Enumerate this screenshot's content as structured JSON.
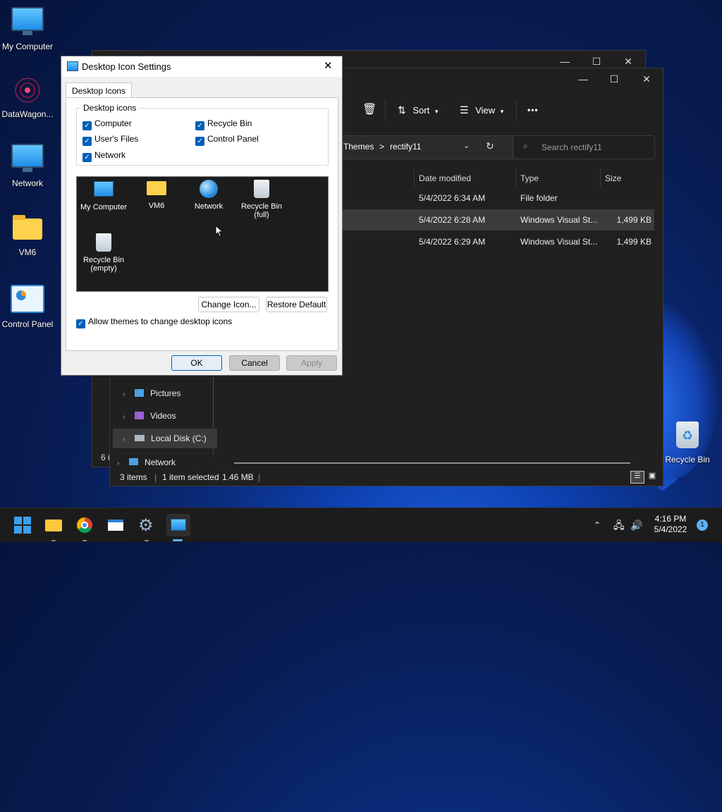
{
  "desktop": {
    "icons": [
      {
        "label": "My Computer"
      },
      {
        "label": "DataWagon..."
      },
      {
        "label": "Network"
      },
      {
        "label": "VM6"
      },
      {
        "label": "Control Panel"
      },
      {
        "label": "Recycle Bin"
      }
    ]
  },
  "explorer": {
    "toolbar": {
      "sort": "Sort",
      "view": "View",
      "more": "•••"
    },
    "address": {
      "crumb1": "Themes",
      "sep": ">",
      "crumb2": "rectify11"
    },
    "search": {
      "placeholder": "Search rectify11"
    },
    "columns": {
      "modified": "Date modified",
      "type": "Type",
      "size": "Size"
    },
    "rows": [
      {
        "modified": "5/4/2022 6:34 AM",
        "type": "File folder",
        "size": ""
      },
      {
        "modified": "5/4/2022 6:28 AM",
        "type": "Windows Visual St...",
        "size": "1,499 KB"
      },
      {
        "modified": "5/4/2022 6:29 AM",
        "type": "Windows Visual St...",
        "size": "1,499 KB"
      }
    ],
    "nav": [
      {
        "label": "Pictures"
      },
      {
        "label": "Videos"
      },
      {
        "label": "Local Disk (C:)"
      },
      {
        "label": "Network"
      }
    ],
    "back_status": "6 i",
    "status": {
      "items": "3 items",
      "selected": "1 item selected",
      "size": "1.46 MB"
    }
  },
  "dialog": {
    "title": "Desktop Icon Settings",
    "tab": "Desktop Icons",
    "group_label": "Desktop icons",
    "checkboxes": [
      {
        "label": "Computer",
        "checked": true
      },
      {
        "label": "Recycle Bin",
        "checked": true
      },
      {
        "label": "User's Files",
        "checked": true
      },
      {
        "label": "Control Panel",
        "checked": true
      },
      {
        "label": "Network",
        "checked": true
      }
    ],
    "preview": [
      {
        "line1": "My Computer",
        "line2": ""
      },
      {
        "line1": "VM6",
        "line2": ""
      },
      {
        "line1": "Network",
        "line2": ""
      },
      {
        "line1": "Recycle Bin",
        "line2": "(full)"
      },
      {
        "line1": "Recycle Bin",
        "line2": "(empty)"
      }
    ],
    "change_icon": "Change Icon...",
    "restore_default": "Restore Default",
    "allow_themes": "Allow themes to change desktop icons",
    "ok": "OK",
    "cancel": "Cancel",
    "apply": "Apply"
  },
  "taskbar": {
    "time": "4:16 PM",
    "date": "5/4/2022",
    "notifications": "1"
  }
}
